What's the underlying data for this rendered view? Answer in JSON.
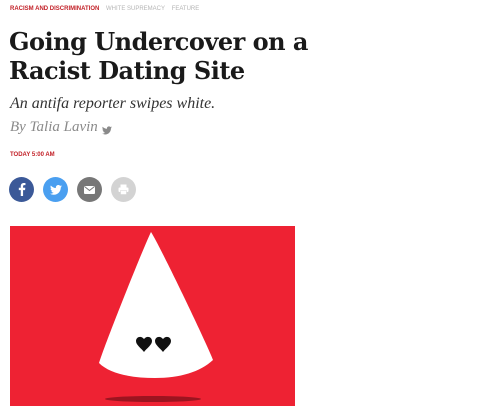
{
  "tags": {
    "primary": "Racism and Discrimination",
    "secondary": [
      "White Supremacy",
      "Feature"
    ]
  },
  "article": {
    "title": "Going Undercover on a Racist Dating Site",
    "dek": "An antifa reporter swipes white.",
    "byline": "By Talia Lavin",
    "timestamp": "Today 5:00 AM"
  },
  "share": {
    "buttons": [
      {
        "icon": "facebook-icon",
        "color": "#3b5998"
      },
      {
        "icon": "twitter-icon",
        "color": "#4a9ff0"
      },
      {
        "icon": "email-icon",
        "color": "#777777"
      },
      {
        "icon": "print-icon",
        "color": "#d3d3d3"
      }
    ]
  },
  "hero_image": {
    "background_color": "#ee2233",
    "figure_color": "#ffffff",
    "eyes_color": "#111111"
  }
}
